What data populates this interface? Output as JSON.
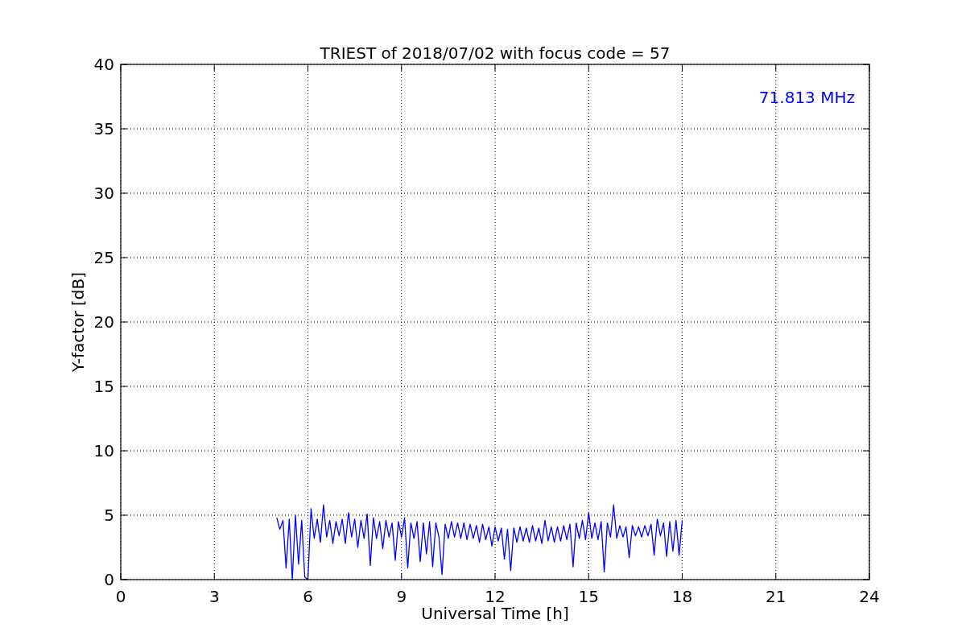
{
  "figure": {
    "chart_data": {
      "type": "line",
      "title": "TRIEST of 2018/07/02 with focus code = 57",
      "xlabel": "Universal Time [h]",
      "ylabel": "Y-factor [dB]",
      "xlim": [
        0,
        24
      ],
      "ylim": [
        0,
        40
      ],
      "grid": true,
      "xticks": [
        0,
        3,
        6,
        9,
        12,
        15,
        18,
        21,
        24
      ],
      "yticks": [
        0,
        5,
        10,
        15,
        20,
        25,
        30,
        35,
        40
      ],
      "x": [
        5.0,
        5.1,
        5.2,
        5.3,
        5.4,
        5.5,
        5.6,
        5.7,
        5.8,
        5.9,
        6.0,
        6.1,
        6.2,
        6.3,
        6.4,
        6.5,
        6.6,
        6.7,
        6.8,
        6.9,
        7.0,
        7.1,
        7.2,
        7.3,
        7.4,
        7.5,
        7.6,
        7.7,
        7.8,
        7.9,
        8.0,
        8.1,
        8.2,
        8.3,
        8.4,
        8.5,
        8.6,
        8.7,
        8.8,
        8.9,
        9.0,
        9.1,
        9.2,
        9.3,
        9.4,
        9.5,
        9.6,
        9.7,
        9.8,
        9.9,
        10.0,
        10.1,
        10.2,
        10.3,
        10.4,
        10.5,
        10.6,
        10.7,
        10.8,
        10.9,
        11.0,
        11.1,
        11.2,
        11.3,
        11.4,
        11.5,
        11.6,
        11.7,
        11.8,
        11.9,
        12.0,
        12.1,
        12.2,
        12.3,
        12.4,
        12.5,
        12.6,
        12.7,
        12.8,
        12.9,
        13.0,
        13.1,
        13.2,
        13.3,
        13.4,
        13.5,
        13.6,
        13.7,
        13.8,
        13.9,
        14.0,
        14.1,
        14.2,
        14.3,
        14.4,
        14.5,
        14.6,
        14.7,
        14.8,
        14.9,
        15.0,
        15.1,
        15.2,
        15.3,
        15.4,
        15.5,
        15.6,
        15.7,
        15.8,
        15.9,
        16.0,
        16.1,
        16.2,
        16.3,
        16.4,
        16.5,
        16.6,
        16.7,
        16.8,
        16.9,
        17.0,
        17.1,
        17.2,
        17.3,
        17.4,
        17.5,
        17.6,
        17.7,
        17.8,
        17.9,
        18.0
      ],
      "series": [
        {
          "color": "#0000ff",
          "values": [
            4.8,
            3.9,
            4.6,
            0.9,
            4.7,
            0.0,
            5.0,
            1.2,
            4.6,
            0.2,
            0.0,
            5.5,
            3.2,
            4.7,
            2.9,
            5.8,
            3.3,
            4.6,
            2.8,
            4.5,
            3.4,
            4.7,
            2.8,
            5.2,
            3.3,
            4.7,
            2.5,
            4.6,
            3.2,
            5.1,
            1.1,
            4.8,
            3.2,
            4.5,
            2.4,
            4.6,
            3.3,
            4.4,
            1.5,
            4.5,
            3.3,
            4.8,
            0.9,
            4.4,
            3.2,
            4.5,
            1.4,
            4.4,
            2.0,
            4.5,
            1.0,
            4.4,
            3.3,
            0.4,
            4.3,
            3.2,
            4.5,
            3.3,
            4.4,
            3.2,
            4.4,
            3.1,
            4.3,
            3.2,
            4.2,
            2.9,
            4.3,
            3.1,
            4.1,
            2.6,
            4.1,
            3.0,
            4.0,
            1.6,
            3.9,
            0.7,
            4.0,
            2.9,
            4.1,
            3.0,
            4.0,
            2.9,
            4.2,
            3.0,
            4.0,
            2.8,
            4.6,
            3.0,
            4.1,
            2.9,
            4.1,
            3.0,
            4.2,
            3.1,
            4.3,
            1.0,
            4.4,
            3.2,
            4.6,
            3.1,
            5.2,
            3.2,
            4.4,
            3.1,
            4.5,
            0.6,
            4.4,
            3.3,
            5.8,
            3.2,
            4.2,
            3.3,
            4.1,
            1.7,
            4.2,
            3.4,
            4.1,
            3.3,
            4.2,
            3.4,
            4.3,
            1.9,
            4.7,
            3.4,
            4.4,
            1.8,
            4.5,
            2.2,
            4.6,
            1.9,
            4.6
          ]
        }
      ],
      "annotations": [
        "71.813 MHz"
      ]
    }
  }
}
